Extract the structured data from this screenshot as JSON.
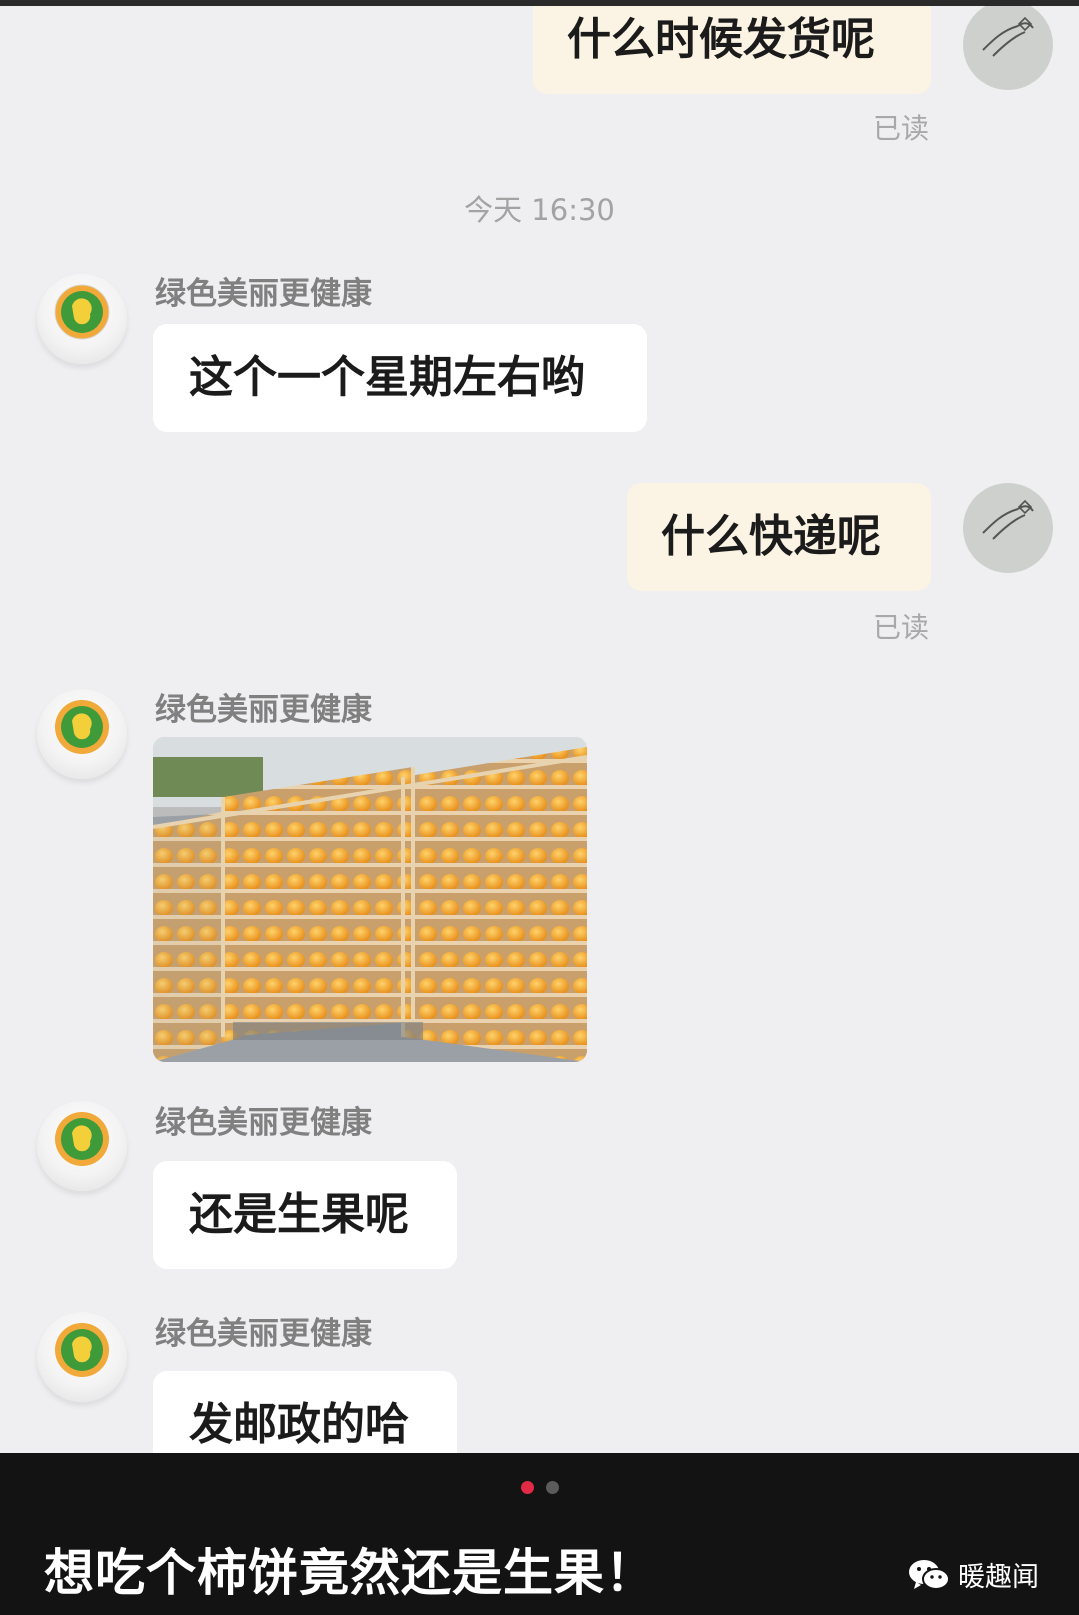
{
  "conversation": {
    "messages": [
      {
        "direction": "outgoing",
        "text": "什么时候发货呢",
        "status": "已读"
      },
      {
        "type": "timestamp",
        "text": "今天 16:30"
      },
      {
        "direction": "incoming",
        "sender": "绿色美丽更健康",
        "text": "这个一个星期左右哟"
      },
      {
        "direction": "outgoing",
        "text": "什么快递呢",
        "status": "已读"
      },
      {
        "direction": "incoming",
        "sender": "绿色美丽更健康",
        "image": "persimmons-on-drying-racks-photo"
      },
      {
        "direction": "incoming",
        "sender": "绿色美丽更健康",
        "text": "还是生果呢"
      },
      {
        "direction": "incoming",
        "sender": "绿色美丽更健康",
        "text": "发邮政的哈"
      }
    ]
  },
  "carousel": {
    "active_dot": 0,
    "dot_count": 2
  },
  "caption": "想吃个柿饼竟然还是生果！",
  "brand": {
    "icon": "wechat-icon",
    "name": "暖趣闻"
  },
  "colors": {
    "chat_background": "#efeff1",
    "outgoing_bubble": "#fbf3e3",
    "incoming_bubble": "#ffffff",
    "caption_bar": "#131313",
    "active_dot": "#e02a46"
  }
}
